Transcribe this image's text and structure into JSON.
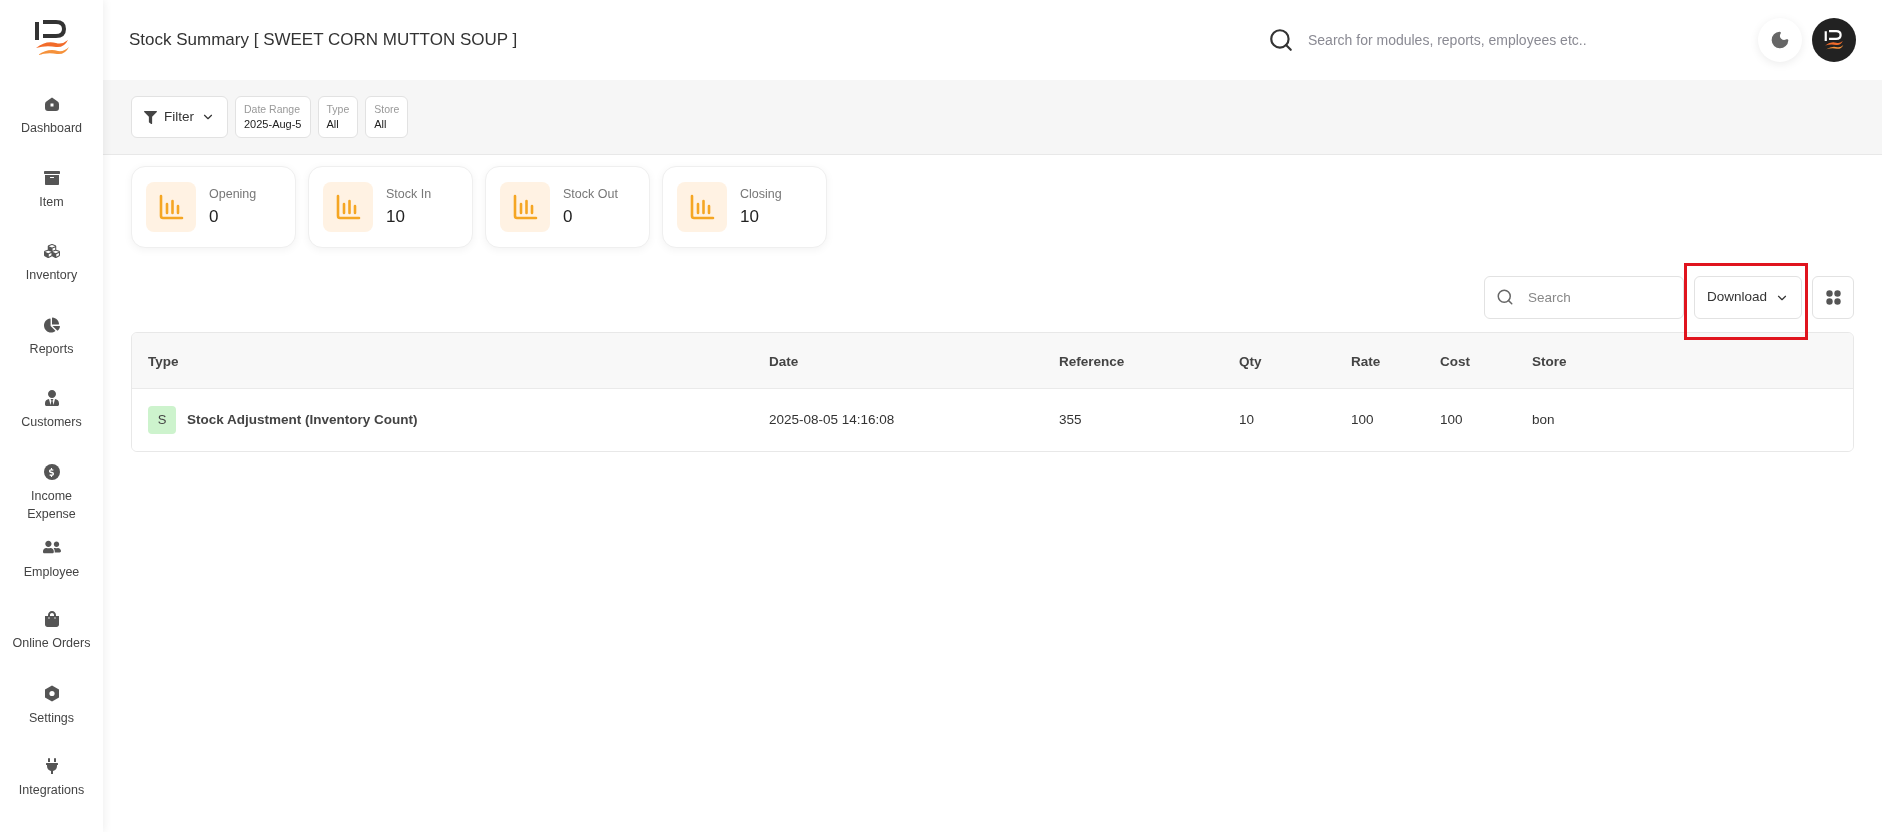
{
  "sidebar": {
    "items": [
      {
        "label": "Dashboard"
      },
      {
        "label": "Item"
      },
      {
        "label": "Inventory"
      },
      {
        "label": "Reports"
      },
      {
        "label": "Customers"
      },
      {
        "label": "Income Expense"
      },
      {
        "label": "Employee"
      },
      {
        "label": "Online Orders"
      },
      {
        "label": "Settings"
      },
      {
        "label": "Integrations"
      }
    ]
  },
  "header": {
    "title": "Stock Summary [ SWEET CORN MUTTON SOUP ]",
    "search": {
      "placeholder": "Search for modules, reports, employees etc.."
    }
  },
  "filters": {
    "filter_button": "Filter",
    "chips": [
      {
        "label": "Date Range",
        "value": "2025-Aug-5"
      },
      {
        "label": "Type",
        "value": "All"
      },
      {
        "label": "Store",
        "value": "All"
      }
    ]
  },
  "summary_cards": [
    {
      "label": "Opening",
      "value": "0"
    },
    {
      "label": "Stock In",
      "value": "10"
    },
    {
      "label": "Stock Out",
      "value": "0"
    },
    {
      "label": "Closing",
      "value": "10"
    }
  ],
  "toolbar": {
    "search": {
      "placeholder": "Search"
    },
    "download_button": "Download",
    "download_highlighted": true
  },
  "table": {
    "columns": [
      "Type",
      "Date",
      "Reference",
      "Qty",
      "Rate",
      "Cost",
      "Store"
    ],
    "rows": [
      {
        "badge": "S",
        "cells": [
          "Stock Adjustment (Inventory Count)",
          "2025-08-05 14:16:08",
          "355",
          "10",
          "100",
          "100",
          "bon"
        ]
      }
    ]
  }
}
